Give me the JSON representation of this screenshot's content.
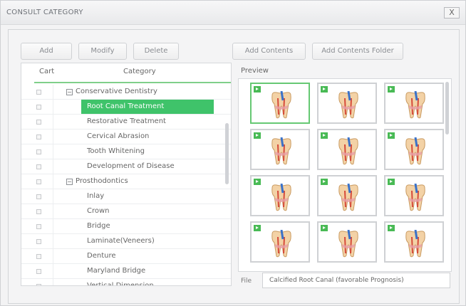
{
  "window": {
    "title": "CONSULT CATEGORY",
    "close_label": "X"
  },
  "toolbar": {
    "add": "Add",
    "modify": "Modify",
    "delete": "Delete",
    "add_contents": "Add Contents",
    "add_contents_folder": "Add Contents Folder"
  },
  "tree": {
    "headers": {
      "cart": "Cart",
      "category": "Category"
    },
    "rows": [
      {
        "label": "Conservative Dentistry",
        "kind": "group",
        "expander": "−",
        "selected": false
      },
      {
        "label": "Root Canal Treatment",
        "kind": "item",
        "selected": true
      },
      {
        "label": "Restorative Treatment",
        "kind": "item",
        "selected": false
      },
      {
        "label": "Cervical Abrasion",
        "kind": "item",
        "selected": false
      },
      {
        "label": "Tooth Whitening",
        "kind": "item",
        "selected": false
      },
      {
        "label": "Development of Disease",
        "kind": "item",
        "selected": false
      },
      {
        "label": "Prosthodontics",
        "kind": "group",
        "expander": "−",
        "selected": false
      },
      {
        "label": "Inlay",
        "kind": "item",
        "selected": false
      },
      {
        "label": "Crown",
        "kind": "item",
        "selected": false
      },
      {
        "label": "Bridge",
        "kind": "item",
        "selected": false
      },
      {
        "label": "Laminate(Veneers)",
        "kind": "item",
        "selected": false
      },
      {
        "label": "Denture",
        "kind": "item",
        "selected": false
      },
      {
        "label": "Maryland Bridge",
        "kind": "item",
        "selected": false
      },
      {
        "label": "Vertical Dimension",
        "kind": "item",
        "selected": false
      }
    ]
  },
  "preview": {
    "label": "Preview",
    "thumbnails": [
      {
        "icon": "tooth-root-canal-icon",
        "active": true
      },
      {
        "icon": "tooth-root-canal-icon",
        "active": false
      },
      {
        "icon": "tooth-root-canal-icon",
        "active": false
      },
      {
        "icon": "tooth-root-canal-icon",
        "active": false
      },
      {
        "icon": "tooth-root-canal-icon",
        "active": false
      },
      {
        "icon": "tooth-root-canal-icon",
        "active": false
      },
      {
        "icon": "tooth-root-canal-icon",
        "active": false
      },
      {
        "icon": "tooth-root-canal-icon",
        "active": false
      },
      {
        "icon": "tooth-root-canal-icon",
        "active": false
      },
      {
        "icon": "tooth-root-canal-icon",
        "active": false
      },
      {
        "icon": "tooth-root-canal-icon",
        "active": false
      },
      {
        "icon": "tooth-root-canal-icon",
        "active": false
      }
    ]
  },
  "file": {
    "label": "File",
    "value": "Calcified Root Canal (favorable Prognosis)"
  },
  "colors": {
    "selection": "#3fc36a",
    "play_badge": "#49ba55",
    "active_border": "#66c873"
  }
}
